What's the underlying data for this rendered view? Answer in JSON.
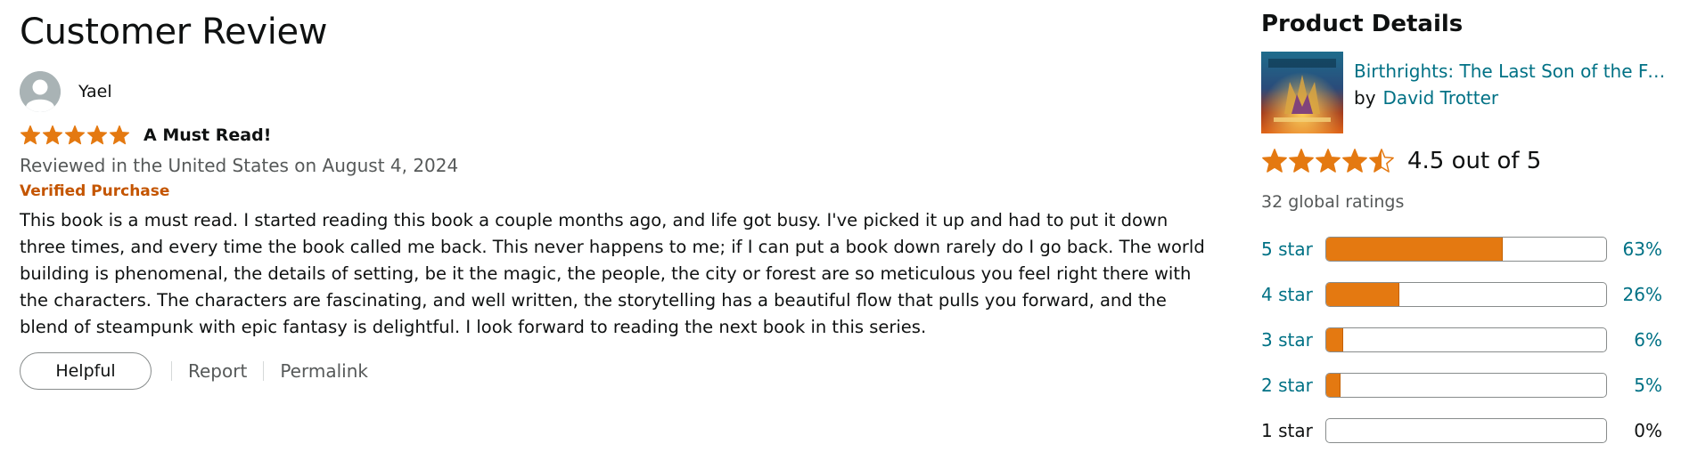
{
  "review": {
    "section_title": "Customer Review",
    "reviewer_name": "Yael",
    "rating": 5,
    "title": "A Must Read!",
    "date": "Reviewed in the United States on August 4, 2024",
    "verified": "Verified Purchase",
    "body": "This book is a must read. I started reading this book a couple months ago, and life got busy. I've picked it up and had to put it down three times, and every time the book called me back. This never happens to me; if I can put a book down rarely do I go back. The world building is phenomenal, the details of setting, be it the magic, the people, the city or forest are so meticulous you feel right there with the characters. The characters are fascinating, and well written, the storytelling has a beautiful flow that pulls you forward, and the blend of steampunk with epic fantasy is delightful. I look forward to reading the next book in this series.",
    "actions": {
      "helpful": "Helpful",
      "report": "Report",
      "permalink": "Permalink"
    }
  },
  "product": {
    "section_title": "Product Details",
    "title": "Birthrights: The Last Son of the Fe...",
    "by": "by",
    "author": "David Trotter",
    "rating_value": 4.5,
    "rating_text": "4.5 out of 5",
    "global_ratings": "32 global ratings",
    "histogram": [
      {
        "label": "5 star",
        "percent": 63,
        "percent_text": "63%"
      },
      {
        "label": "4 star",
        "percent": 26,
        "percent_text": "26%"
      },
      {
        "label": "3 star",
        "percent": 6,
        "percent_text": "6%"
      },
      {
        "label": "2 star",
        "percent": 5,
        "percent_text": "5%"
      },
      {
        "label": "1 star",
        "percent": 0,
        "percent_text": "0%"
      }
    ]
  },
  "colors": {
    "star": "#e47911",
    "link": "#007185",
    "verified": "#c45500",
    "bar_fill": "#e47911"
  }
}
